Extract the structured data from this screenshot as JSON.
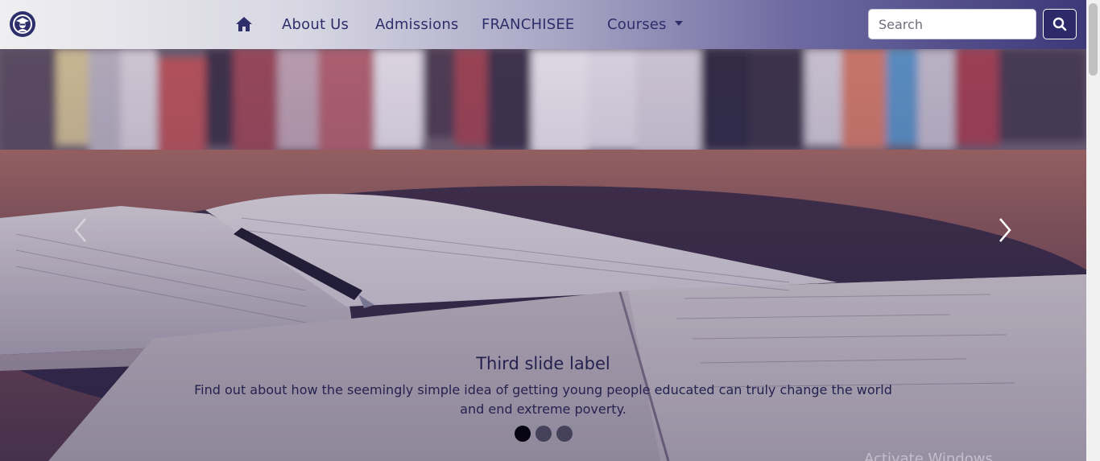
{
  "navbar": {
    "brand_icon": "graduate-logo-icon",
    "home_icon": "home-icon",
    "links": [
      "About Us",
      "Admissions",
      "FRANCHISEE"
    ],
    "courses_label": "Courses",
    "search": {
      "placeholder": "Search",
      "value": "",
      "button_icon": "search-icon"
    }
  },
  "carousel": {
    "slide_label": "Third slide label",
    "slide_text": "Find out about how the seemingly simple idea of getting young people educated can truly change the world and end extreme poverty.",
    "prev_icon": "chevron-left-icon",
    "next_icon": "chevron-right-icon",
    "indicator_count": 3,
    "active_indicator": 1
  },
  "overlay": {
    "watermark": "Activate Windows"
  },
  "colors": {
    "navy": "#2e2f6a",
    "nav_gradient_end": "#3d3878",
    "indicator_active": "#050410"
  }
}
